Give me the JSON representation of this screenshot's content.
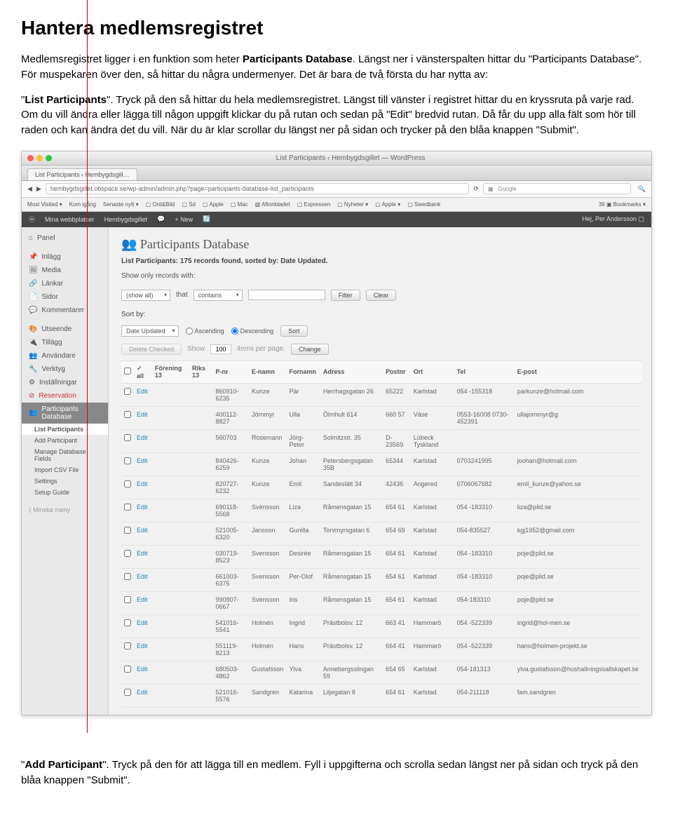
{
  "doc": {
    "title": "Hantera medlemsregistret",
    "p1a": "Medlemsregistret ligger i en funktion som heter ",
    "p1b": "Participants Database",
    "p1c": ". Längst ner i vänsterspalten hittar du \"Participants Database\". För muspekaren över den, så hittar du några undermenyer. Det är bara de två första du har nytta av:",
    "p2a": "\"",
    "p2b": "List Participants",
    "p2c": "\". Tryck på den så hittar du hela medlemsregistret. Längst till vänster i registret hittar du en kryssruta på varje rad. Om du vill ändra eller lägga till någon uppgift klickar du på rutan och sedan på \"Edit\" bredvid rutan. Då får du upp alla fält som hör till raden och kan ändra det du vill. När du är klar scrollar du längst ner på sidan och trycker på den blåa knappen \"Submit\"."
  },
  "browser": {
    "title": "List Participants ‹ Hembygdsgillet — WordPress",
    "tab": "List Participants ‹ Hembygdsgill…",
    "url": "hembygdsgillet.obspace.se/wp-admin/admin.php?page=participants-database-list_participants",
    "search_prefix": "▦ · Google",
    "bookmarks": {
      "mv": "Most Visited ▾",
      "ki": "Kom igång",
      "sn": "Senaste nytt ▾",
      "ob": "▢ Ord&Bild",
      "sd": "▢ Sd",
      "ap": "▢ Apple",
      "mac": "▢ Mac",
      "ab": "▧ Aftonbladet",
      "ex": "▢ Expressen",
      "ny": "▢ Nyheter ▾",
      "ap2": "▢ Apple ▾",
      "sw": "▢ Swedbank",
      "bm": "39 ▣ Bookmarks ▾"
    }
  },
  "wpbar": {
    "sites": "Mina webbplatser",
    "site": "Hembygdsgillet",
    "comments": "💬",
    "new": "+ New",
    "e": "🔄",
    "greeting": "Hej, Per Andersson ▢"
  },
  "sidebar": {
    "panel": "Panel",
    "items": [
      "Inlägg",
      "Media",
      "Länkar",
      "Sidor",
      "Kommentarer"
    ],
    "items2": [
      "Utseende",
      "Tillägg",
      "Användare",
      "Verktyg",
      "Inställningar",
      "Reservation"
    ],
    "active": "Participants Database",
    "subs": [
      "List Participants",
      "Add Participant",
      "Manage Database Fields",
      "Import CSV File",
      "Settings",
      "Setup Guide"
    ],
    "collapse": "⟨ Minska meny"
  },
  "main": {
    "h2": "Participants Database",
    "subhead": "List Participants: 175 records found, sorted by: Date Updated.",
    "filter_label": "Show only records with:",
    "filter_field": "(show all)",
    "filter_that": "that",
    "filter_op": "contains",
    "btn_filter": "Filter",
    "btn_clear": "Clear",
    "sort_label": "Sort by:",
    "sort_field": "Date Updated",
    "asc": "Ascending",
    "desc": "Descending",
    "btn_sort": "Sort",
    "delete_checked": "Delete Checked",
    "show": "Show",
    "items_per_page_val": "100",
    "items_per_page": "items per page.",
    "btn_change": "Change",
    "cols": {
      "all": "✓ all",
      "forening": "Förening 13",
      "riks": "Riks 13",
      "pnr": "P-nr",
      "enamn": "E-namn",
      "fornamn": "Fornamn",
      "adress": "Adress",
      "postnr": "Postnr",
      "ort": "Ort",
      "tel": "Tel",
      "epost": "E-post"
    },
    "edit": "Edit",
    "rows": [
      {
        "pnr": "860910-6235",
        "en": "Kunze",
        "fn": "Pär",
        "adr": "Herrhagsgatan 26",
        "pn": "65222",
        "ort": "Karlstad",
        "tel": "054 -155318",
        "ep": "parkunze@hotmail.com"
      },
      {
        "pnr": "400112-8827",
        "en": "Jörnmyr",
        "fn": "Ulla",
        "adr": "Ölmhult 614",
        "pn": "660 57",
        "ort": "Väse",
        "tel": "0553-16008 0730-452391",
        "ep": "ullajornmyr@g"
      },
      {
        "pnr": "560703",
        "en": "Rosemann",
        "fn": "Jörg-Peter",
        "adr": "Solmitzstr. 35",
        "pn": "D-23569",
        "ort": "Lübeck Tyskland",
        "tel": "",
        "ep": ""
      },
      {
        "pnr": "840426-6259",
        "en": "Kunze",
        "fn": "Johan",
        "adr": "Petersbergsgatan 35B",
        "pn": "65344",
        "ort": "Karlstad",
        "tel": "0703241995",
        "ep": "joohan@hotmail.com"
      },
      {
        "pnr": "820727-6232",
        "en": "Kunze",
        "fn": "Emil",
        "adr": "Sandeslätt 34",
        "pn": "42436",
        "ort": "Angered",
        "tel": "0706067682",
        "ep": "emil_kunze@yahoo.se"
      },
      {
        "pnr": "690118-5568",
        "en": "Svensson",
        "fn": "Liza",
        "adr": "Råmensgatan 15",
        "pn": "654 61",
        "ort": "Karlstad",
        "tel": "054 -183310",
        "ep": "liza@plid.se"
      },
      {
        "pnr": "521005-6320",
        "en": "Jansson",
        "fn": "Gunilla",
        "adr": "Torvmyrsgatan 6",
        "pn": "654 69",
        "ort": "Karlstad",
        "tel": "054-835527",
        "ep": "kgj1952@gmail.com"
      },
      {
        "pnr": "030719-8523",
        "en": "Svensson",
        "fn": "Desirée",
        "adr": "Råmensgatan 15",
        "pn": "654 61",
        "ort": "Karlstad",
        "tel": "054 -183310",
        "ep": "poje@plid.se"
      },
      {
        "pnr": "661003-6375",
        "en": "Svensson",
        "fn": "Per-Olof",
        "adr": "Råmensgatan 15",
        "pn": "654 61",
        "ort": "Karlstad",
        "tel": "054 -183310",
        "ep": "poje@plid.se"
      },
      {
        "pnr": "990907-0667",
        "en": "Svensson",
        "fn": "Iris",
        "adr": "Råmensgatan 15",
        "pn": "654 61",
        "ort": "Karlstad",
        "tel": "054-183310",
        "ep": "poje@plid.se"
      },
      {
        "pnr": "541016-5541",
        "en": "Holmén",
        "fn": "Ingrid",
        "adr": "Prästbolsv. 12",
        "pn": "663 41",
        "ort": "Hammarö",
        "tel": "054 -522339",
        "ep": "ingrid@hol-men.se"
      },
      {
        "pnr": "551119-8213",
        "en": "Holmén",
        "fn": "Hans",
        "adr": "Prästbolsv. 12",
        "pn": "664 41",
        "ort": "Hammarö",
        "tel": "054 -522339",
        "ep": "hans@holmen-projekt.se"
      },
      {
        "pnr": "680503-4862",
        "en": "Gustafsson",
        "fn": "Ylva",
        "adr": "Annebergsslingan 59",
        "pn": "654 65",
        "ort": "Karlstad",
        "tel": "054-181313",
        "ep": "ylva.gustafsson@hushallningssallskapet.se"
      },
      {
        "pnr": "521016-5576",
        "en": "Sandgren",
        "fn": "Katarina",
        "adr": "Liljegatan 8",
        "pn": "654 61",
        "ort": "Karlstad",
        "tel": "054-211118",
        "ep": "fam.sandgren"
      }
    ]
  },
  "footer": {
    "a": "\"",
    "b": "Add Participant",
    "c": "\". Tryck på den för att lägga till en medlem. Fyll i uppgifterna och scrolla sedan längst ner på sidan och tryck på den blåa knappen \"Submit\"."
  }
}
